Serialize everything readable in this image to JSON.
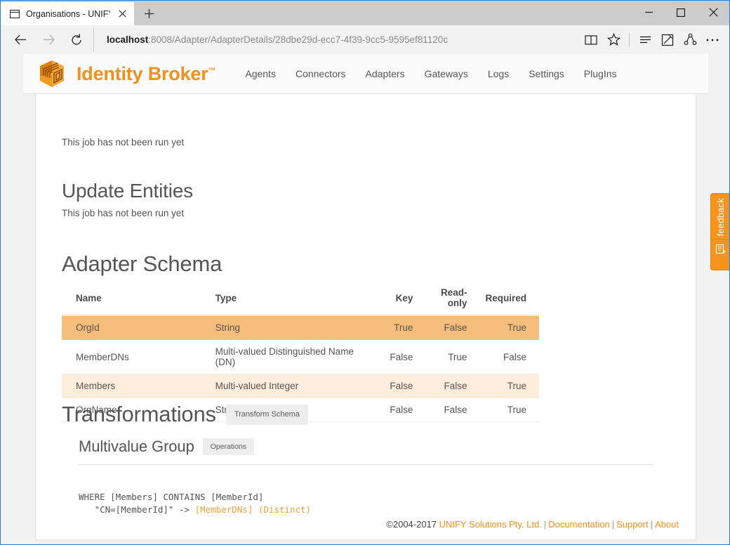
{
  "browser": {
    "tab": {
      "title": "Organisations - UNIFY Ic",
      "favicon_icon": "window-icon",
      "close_icon": "close-icon"
    },
    "new_tab_label": "+",
    "window_controls": {
      "minimize": "minimize-icon",
      "maximize": "maximize-icon",
      "close": "close-icon"
    },
    "nav": {
      "back_icon": "back-arrow-icon",
      "forward_icon": "forward-arrow-icon",
      "refresh_icon": "refresh-icon"
    },
    "url": {
      "host": "localhost",
      "rest": ":8008/Adapter/AdapterDetails/28dbe29d-ecc7-4f39-9cc5-9595ef81120c",
      "full": "localhost:8008/Adapter/AdapterDetails/28dbe29d-ecc7-4f39-9cc5-9595ef81120c"
    },
    "toolbar": {
      "reading_view_icon": "book-icon",
      "favorites_icon": "star-icon",
      "hub_icon": "hub-lines-icon",
      "web_note_icon": "pencil-square-icon",
      "share_icon": "share-icon",
      "more_icon": "ellipsis-icon"
    }
  },
  "site": {
    "brand": {
      "name": "Identity Broker",
      "tm": "™",
      "logo_icon": "cube-maze-logo-icon"
    },
    "nav_items": [
      {
        "label": "Agents"
      },
      {
        "label": "Connectors"
      },
      {
        "label": "Adapters"
      },
      {
        "label": "Gateways"
      },
      {
        "label": "Logs"
      },
      {
        "label": "Settings"
      },
      {
        "label": "PlugIns"
      }
    ],
    "accent_color": "#f3901d"
  },
  "main": {
    "scrolled_note": "This job has not been run yet",
    "update_entities": {
      "heading": "Update Entities",
      "note": "This job has not been run yet"
    },
    "adapter_schema": {
      "heading": "Adapter Schema",
      "columns": [
        "Name",
        "Type",
        "Key",
        "Read-only",
        "Required"
      ],
      "rows": [
        {
          "name": "OrgId",
          "type": "String",
          "key": "True",
          "read_only": "False",
          "required": "True",
          "highlight": "strong"
        },
        {
          "name": "MemberDNs",
          "type": "Multi-valued Distinguished Name (DN)",
          "key": "False",
          "read_only": "True",
          "required": "False",
          "highlight": "none"
        },
        {
          "name": "Members",
          "type": "Multi-valued Integer",
          "key": "False",
          "read_only": "False",
          "required": "True",
          "highlight": "soft"
        },
        {
          "name": "OrgName",
          "type": "String",
          "key": "False",
          "read_only": "False",
          "required": "True",
          "highlight": "none"
        }
      ],
      "highlight_strong_color": "#f6bd7b",
      "highlight_soft_color": "#fdeedc"
    },
    "transformations": {
      "heading": "Transformations",
      "action_label": "Transform Schema",
      "group": {
        "heading": "Multivalue Group",
        "action_label": "Operations",
        "code_line1": "WHERE [Members] CONTAINS [MemberId]",
        "code_line2_prefix": "   \"CN=[MemberId]\" -> ",
        "code_line2_accent": "[MemberDNs] (Distinct)",
        "accent_color": "#e8a33d"
      }
    }
  },
  "footer": {
    "copyright": "©2004-2017 ",
    "company": "UNIFY Solutions Pty. Ltd.",
    "links": [
      {
        "label": "Documentation"
      },
      {
        "label": "Support"
      },
      {
        "label": "About"
      }
    ],
    "separator": "|"
  },
  "feedback": {
    "label": "feedback",
    "icon": "feedback-form-icon",
    "color": "#f7941e"
  }
}
